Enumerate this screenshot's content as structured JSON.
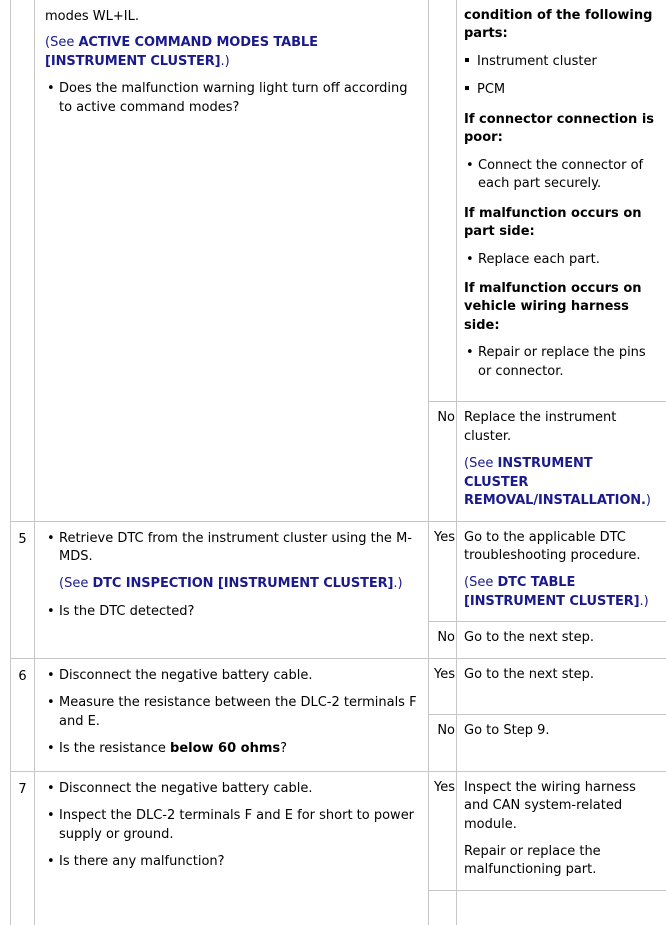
{
  "document": {
    "type": "diagnostic-troubleshooting-table",
    "columns": {
      "step": "",
      "inspection": "",
      "result": "",
      "action": ""
    }
  },
  "rows": [
    {
      "step": "",
      "inspection": {
        "continued_line": "modes WL+IL.",
        "xref_prefix": "(See ",
        "xref_link": "ACTIVE COMMAND MODES TABLE [INSTRUMENT CLUSTER]",
        "xref_suffix": ".)",
        "question_bullet": "Does the malfunction warning light turn off according to active command modes?"
      },
      "branches": [
        {
          "result": "",
          "action": {
            "head1": "condition of the following parts:",
            "sub_items": [
              "Instrument cluster",
              "PCM"
            ],
            "head2": "If connector connection is poor:",
            "bullets2": [
              "Connect the connector of each part securely."
            ],
            "head3": "If malfunction occurs on part side:",
            "bullets3": [
              "Replace each part."
            ],
            "head4": "If malfunction occurs on vehicle wiring harness side:",
            "bullets4": [
              "Repair or replace the pins or connector."
            ]
          }
        },
        {
          "result": "No",
          "action": {
            "text": "Replace the instrument cluster.",
            "xref_prefix": "(See ",
            "xref_link": "INSTRUMENT CLUSTER REMOVAL/INSTALLATION.",
            "xref_suffix": ")"
          }
        }
      ]
    },
    {
      "step": "5",
      "inspection": {
        "bullet1": "Retrieve DTC from the instrument cluster using the M-MDS.",
        "xref_prefix": "(See ",
        "xref_link": "DTC INSPECTION [INSTRUMENT CLUSTER]",
        "xref_suffix": ".)",
        "bullet2": "Is the DTC detected?"
      },
      "branches": [
        {
          "result": "Yes",
          "action": {
            "text": "Go to the applicable DTC troubleshooting procedure.",
            "xref_prefix": "(See ",
            "xref_link": "DTC TABLE [INSTRUMENT CLUSTER]",
            "xref_suffix": ".)"
          }
        },
        {
          "result": "No",
          "action": {
            "text": "Go to the next step."
          }
        }
      ]
    },
    {
      "step": "6",
      "inspection": {
        "bullet1": "Disconnect the negative battery cable.",
        "bullet2": "Measure the resistance between the DLC-2 terminals F and E.",
        "bullet3_pre": "Is the resistance ",
        "bullet3_bold": "below 60 ohms",
        "bullet3_post": "?"
      },
      "branches": [
        {
          "result": "Yes",
          "action": {
            "text": "Go to the next step."
          }
        },
        {
          "result": "No",
          "action": {
            "text": "Go to Step 9."
          }
        }
      ]
    },
    {
      "step": "7",
      "inspection": {
        "bullet1": "Disconnect the negative battery cable.",
        "bullet2": "Inspect the DLC-2 terminals F and E for short to power supply or ground.",
        "bullet3": "Is there any malfunction?"
      },
      "branches": [
        {
          "result": "Yes",
          "action": {
            "text": "Inspect the wiring harness and CAN system-related module.",
            "text2": "Repair or replace the malfunctioning part."
          }
        },
        {
          "result": "",
          "action": {
            "text": ""
          }
        }
      ]
    }
  ],
  "colors": {
    "link": "#1a1a8c",
    "text": "#000000",
    "border": "#c6c6c6",
    "background": "#ffffff"
  }
}
